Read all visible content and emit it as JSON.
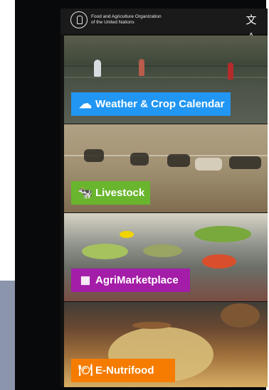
{
  "header": {
    "org_name_line1": "Food and Agriculture Organization",
    "org_name_line2": "of the United Nations",
    "translate_icon": "translate-icon"
  },
  "tiles": [
    {
      "label": "Weather & Crop Calendar",
      "icon": "cloud-icon",
      "color": "#2196f3"
    },
    {
      "label": "Livestock",
      "icon": "cow-icon",
      "color": "#69b52d"
    },
    {
      "label": "AgriMarketplace",
      "icon": "market-icon",
      "color": "#a31da8"
    },
    {
      "label": "E-Nutrifood",
      "icon": "food-icon",
      "color": "#f57c00"
    }
  ]
}
